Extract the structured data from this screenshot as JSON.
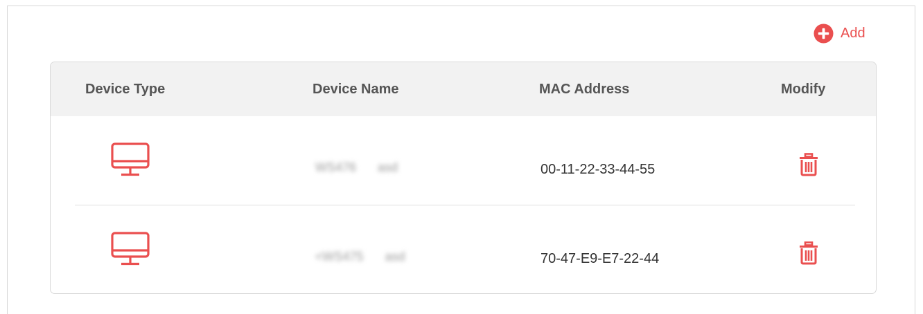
{
  "toolbar": {
    "add_label": "Add",
    "add_icon": "plus-circle-icon"
  },
  "table": {
    "headers": {
      "device_type": "Device Type",
      "device_name": "Device Name",
      "mac_address": "MAC Address",
      "modify": "Modify"
    },
    "rows": [
      {
        "device_type_icon": "desktop-monitor-icon",
        "device_name_part1": "WS476",
        "device_name_part2": "asd",
        "mac_address": "00-11-22-33-44-55",
        "modify_icon": "trash-icon"
      },
      {
        "device_type_icon": "desktop-monitor-icon",
        "device_name_part1": "<WS475",
        "device_name_part2": "asd",
        "mac_address": "70-47-E9-E7-22-44",
        "modify_icon": "trash-icon"
      }
    ]
  },
  "colors": {
    "accent": "#ea4f4f",
    "header_bg": "#f2f2f2",
    "border": "#d9d9d9"
  }
}
